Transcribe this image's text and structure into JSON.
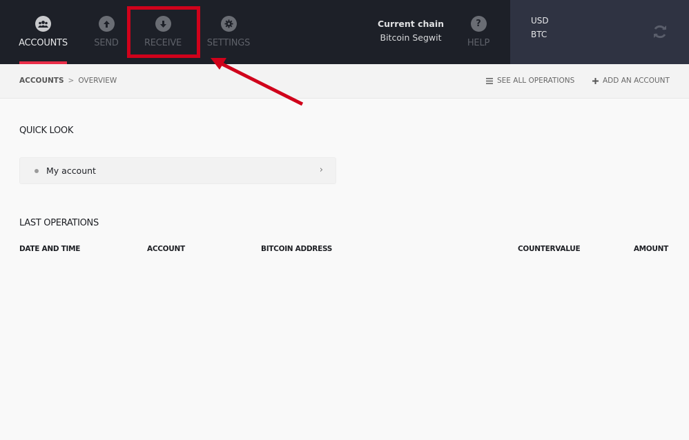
{
  "nav": {
    "items": [
      {
        "label": "ACCOUNTS",
        "icon": "accounts-icon",
        "active": true
      },
      {
        "label": "SEND",
        "icon": "send-icon",
        "active": false
      },
      {
        "label": "RECEIVE",
        "icon": "receive-icon",
        "active": false
      },
      {
        "label": "SETTINGS",
        "icon": "settings-icon",
        "active": false
      }
    ],
    "help_label": "HELP"
  },
  "chain": {
    "title": "Current chain",
    "value": "Bitcoin Segwit"
  },
  "currencies": {
    "primary": "USD",
    "secondary": "BTC"
  },
  "breadcrumb": {
    "root": "ACCOUNTS",
    "separator": ">",
    "current": "OVERVIEW"
  },
  "actions": {
    "see_all_operations": "SEE ALL OPERATIONS",
    "add_account": "ADD AN ACCOUNT"
  },
  "quick_look": {
    "title": "QUICK LOOK",
    "accounts": [
      {
        "name": "My account"
      }
    ]
  },
  "last_operations": {
    "title": "LAST OPERATIONS",
    "columns": [
      "DATE AND TIME",
      "ACCOUNT",
      "BITCOIN ADDRESS",
      "COUNTERVALUE",
      "AMOUNT"
    ],
    "rows": []
  },
  "colors": {
    "accent": "#ea2e49",
    "topbar": "#1d2028",
    "annotation": "#d0021b"
  }
}
